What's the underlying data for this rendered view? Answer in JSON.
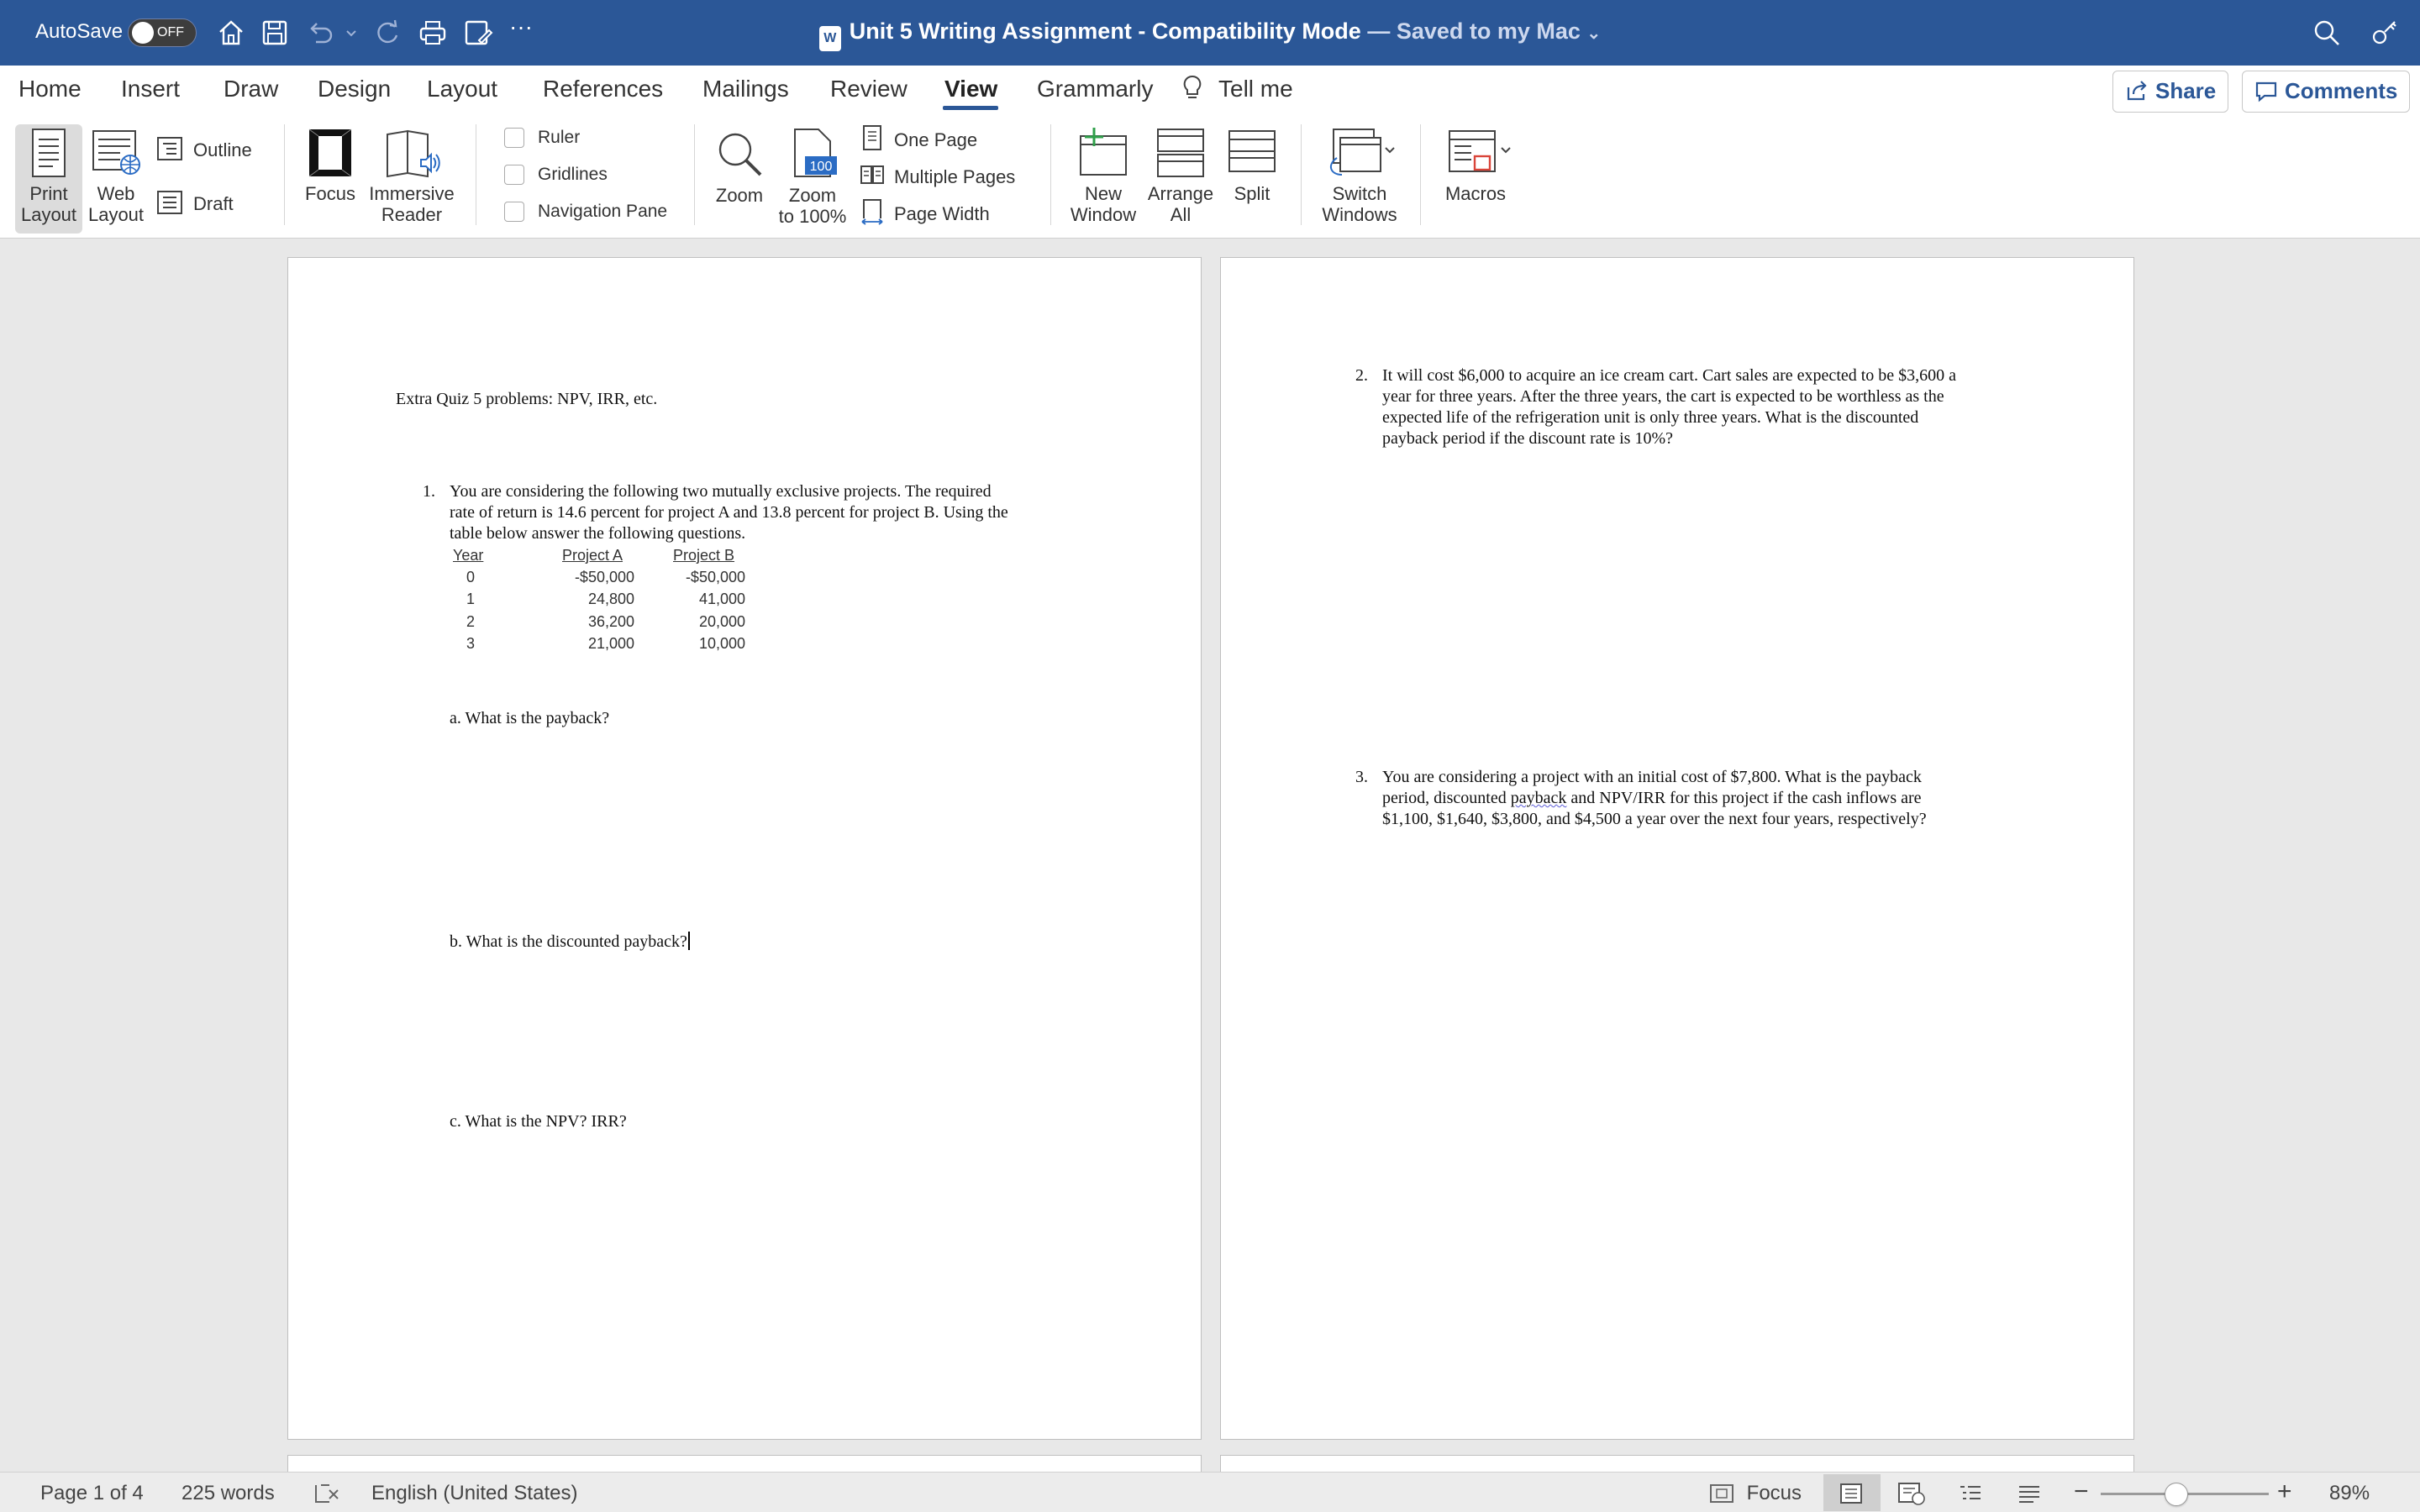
{
  "titlebar": {
    "autosave_label": "AutoSave",
    "autosave_state": "OFF",
    "word_badge": "W",
    "doc_name": "Unit 5 Writing Assignment",
    "separator": " - ",
    "mode": "Compatibility Mode",
    "saved": " — Saved to my Mac",
    "saved_chevron": "⌄",
    "overflow": "···"
  },
  "tabs": [
    "Home",
    "Insert",
    "Draw",
    "Design",
    "Layout",
    "References",
    "Mailings",
    "Review",
    "View",
    "Grammarly",
    "Tell me"
  ],
  "active_tab": "View",
  "share_label": "Share",
  "comments_label": "Comments",
  "ribbon": {
    "print_layout": [
      "Print",
      "Layout"
    ],
    "web_layout": [
      "Web",
      "Layout"
    ],
    "outline": "Outline",
    "draft": "Draft",
    "focus": "Focus",
    "immersive_reader": [
      "Immersive",
      "Reader"
    ],
    "ruler": "Ruler",
    "gridlines": "Gridlines",
    "navigation_pane": "Navigation Pane",
    "zoom": "Zoom",
    "zoom_100": [
      "Zoom",
      "to 100%"
    ],
    "zoom_100_badge": "100",
    "one_page": "One Page",
    "multiple_pages": "Multiple Pages",
    "page_width": "Page Width",
    "new_window": [
      "New",
      "Window"
    ],
    "arrange_all": [
      "Arrange",
      "All"
    ],
    "split": "Split",
    "switch_windows": [
      "Switch",
      "Windows"
    ],
    "macros": "Macros"
  },
  "page1": {
    "heading": "Extra Quiz 5 problems:  NPV, IRR, etc.",
    "q1_num": "1.",
    "q1_lines": [
      "You are considering the following two mutually exclusive projects. The required",
      "rate of return is 14.6 percent for project A and 13.8 percent for project B.  Using the",
      "table below answer the following questions."
    ],
    "table_headers": [
      "Year",
      "Project A",
      "Project B"
    ],
    "table_rows": [
      [
        "0",
        "-$50,000",
        "-$50,000"
      ],
      [
        "1",
        "24,800",
        "41,000"
      ],
      [
        "2",
        "36,200",
        "20,000"
      ],
      [
        "3",
        "21,000",
        "10,000"
      ]
    ],
    "qa": "a. What is the payback?",
    "qb": "b. What is the discounted payback?",
    "qc": "c. What is the NPV?  IRR?"
  },
  "page2": {
    "q2_num": "2.",
    "q2_lines": [
      "It will cost $6,000 to acquire an ice cream cart. Cart sales are expected to be $3,600 a",
      "year for three years. After the three years, the cart is expected to be worthless as the",
      "expected life of the refrigeration unit is only three years. What is the discounted",
      "payback period if the discount rate is 10%?"
    ],
    "q3_num": "3.",
    "q3_line1": "You are considering a project with an initial cost of $7,800. What is the payback",
    "q3_line2_a": "period, discounted ",
    "q3_line2_b": "payback",
    "q3_line2_c": " and NPV/IRR for this project if the cash inflows are",
    "q3_line3": "$1,100, $1,640, $3,800, and $4,500 a year over the next four years, respectively?"
  },
  "statusbar": {
    "page": "Page 1 of 4",
    "words": "225 words",
    "language": "English (United States)",
    "focus": "Focus",
    "zoom_minus": "−",
    "zoom_plus": "+",
    "zoom": "89%"
  }
}
